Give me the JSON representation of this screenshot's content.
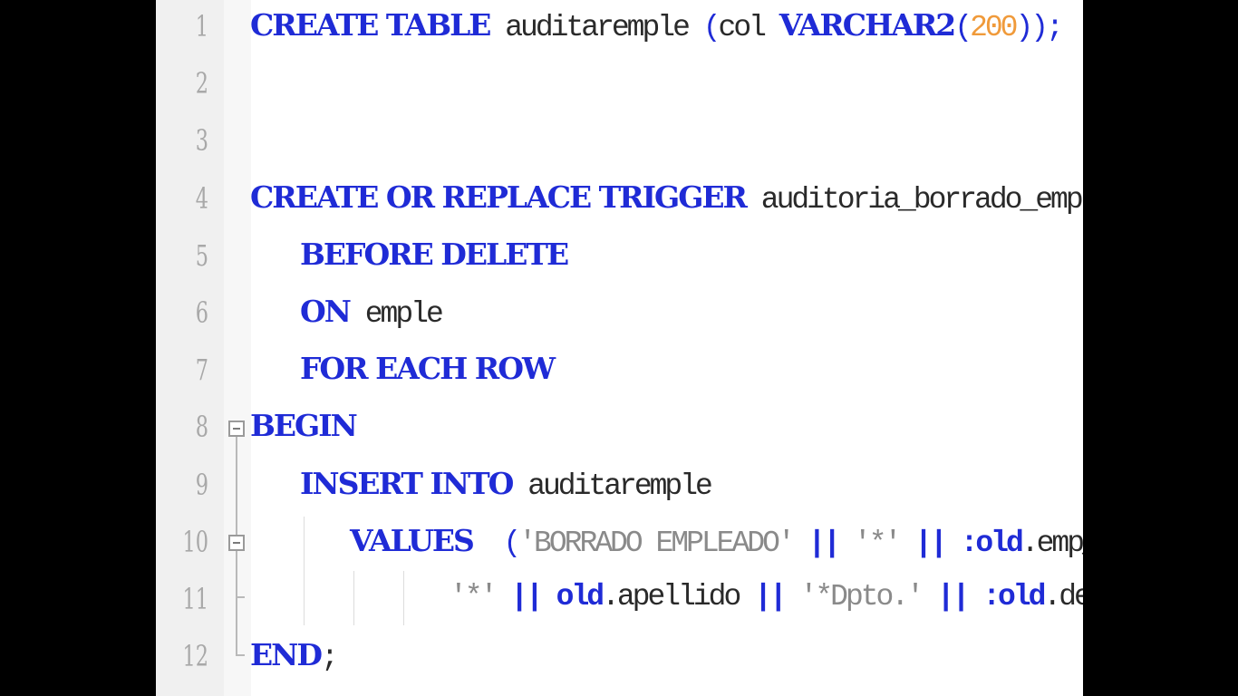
{
  "editor": {
    "lines": [
      {
        "num": "1",
        "tokens": [
          {
            "t": "CREATE TABLE",
            "c": "kw"
          },
          {
            "t": " auditaremple ",
            "c": ""
          },
          {
            "t": "(",
            "c": "paren"
          },
          {
            "t": "col ",
            "c": ""
          },
          {
            "t": "VARCHAR2",
            "c": "kw"
          },
          {
            "t": "(",
            "c": "paren"
          },
          {
            "t": "200",
            "c": "num"
          },
          {
            "t": "));",
            "c": "paren"
          }
        ]
      },
      {
        "num": "2",
        "tokens": []
      },
      {
        "num": "3",
        "tokens": []
      },
      {
        "num": "4",
        "tokens": [
          {
            "t": "CREATE OR REPLACE TRIGGER",
            "c": "kw"
          },
          {
            "t": " auditoria_borrado_emple",
            "c": ""
          }
        ]
      },
      {
        "num": "5",
        "indent": 1,
        "tokens": [
          {
            "t": "BEFORE DELETE",
            "c": "kw"
          }
        ]
      },
      {
        "num": "6",
        "indent": 1,
        "tokens": [
          {
            "t": "ON",
            "c": "kw"
          },
          {
            "t": " emple",
            "c": ""
          }
        ]
      },
      {
        "num": "7",
        "indent": 1,
        "tokens": [
          {
            "t": "FOR EACH ROW",
            "c": "kw"
          }
        ]
      },
      {
        "num": "8",
        "tokens": [
          {
            "t": "BEGIN",
            "c": "kw"
          }
        ]
      },
      {
        "num": "9",
        "indent": 1,
        "tokens": [
          {
            "t": "INSERT INTO",
            "c": "kw"
          },
          {
            "t": " auditaremple",
            "c": ""
          }
        ]
      },
      {
        "num": "10",
        "indent": 2,
        "tokens": [
          {
            "t": "VALUES",
            "c": "kw"
          },
          {
            "t": "  ",
            "c": ""
          },
          {
            "t": "(",
            "c": "paren"
          },
          {
            "t": "'BORRADO EMPLEADO'",
            "c": "str"
          },
          {
            "t": " || ",
            "c": "op"
          },
          {
            "t": "'*'",
            "c": "str"
          },
          {
            "t": " || ",
            "c": "op"
          },
          {
            "t": ":old",
            "c": "op"
          },
          {
            "t": ".emp_no ",
            "c": ""
          },
          {
            "t": "||",
            "c": "op"
          }
        ]
      },
      {
        "num": "11",
        "indent": 4,
        "tokens": [
          {
            "t": "'*'",
            "c": "str"
          },
          {
            "t": " || ",
            "c": "op"
          },
          {
            "t": "old",
            "c": "op"
          },
          {
            "t": ".apellido ",
            "c": ""
          },
          {
            "t": "||",
            "c": "op"
          },
          {
            "t": " ",
            "c": ""
          },
          {
            "t": "'*Dpto.'",
            "c": "str"
          },
          {
            "t": " || ",
            "c": "op"
          },
          {
            "t": ":old",
            "c": "op"
          },
          {
            "t": ".dept_no",
            "c": ""
          },
          {
            "t": ");",
            "c": ""
          }
        ]
      },
      {
        "num": "12",
        "tokens": [
          {
            "t": "END",
            "c": "kw"
          },
          {
            "t": ";",
            "c": ""
          }
        ]
      }
    ]
  },
  "colors": {
    "keyword": "#1f2bd6",
    "number": "#f09a3a",
    "string": "#8a8a8a",
    "text": "#2a2a2a",
    "gutter_text": "#a8a8a8"
  }
}
